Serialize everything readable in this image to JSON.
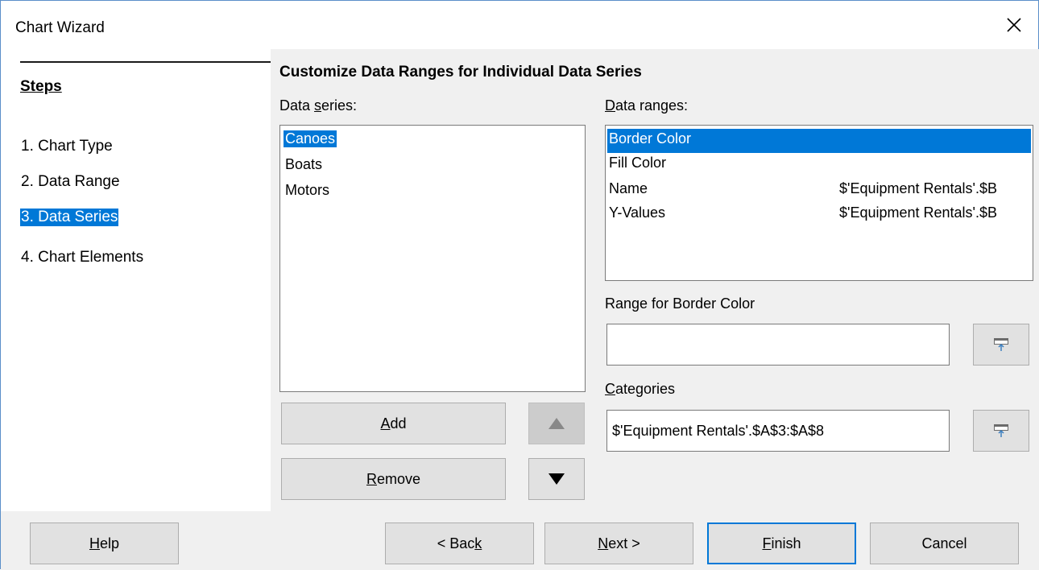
{
  "window": {
    "title": "Chart Wizard"
  },
  "steps": {
    "heading": "Steps",
    "items": [
      {
        "label": "1. Chart Type",
        "active": false
      },
      {
        "label": "2. Data Range",
        "active": false
      },
      {
        "label": "3. Data Series",
        "active": true
      },
      {
        "label": "4. Chart Elements",
        "active": false
      }
    ]
  },
  "main": {
    "section_title": "Customize Data Ranges for Individual Data Series",
    "data_series": {
      "label_pre": "Data ",
      "label_key": "s",
      "label_post": "eries:",
      "items": [
        "Canoes",
        "Boats",
        "Motors"
      ],
      "selected": "Canoes"
    },
    "data_ranges": {
      "label_key": "D",
      "label_post": "ata ranges:",
      "rows": [
        {
          "name": "Border Color",
          "value": ""
        },
        {
          "name": "Fill Color",
          "value": ""
        },
        {
          "name": "Name",
          "value": "$'Equipment Rentals'.$B"
        },
        {
          "name": "Y-Values",
          "value": "$'Equipment Rentals'.$B"
        }
      ],
      "selected": "Border Color"
    },
    "range_for": {
      "label_pre": "Ran",
      "label_key": "g",
      "label_post": "e for Border Color",
      "value": ""
    },
    "categories": {
      "label_key": "C",
      "label_post": "ategories",
      "value": "$'Equipment Rentals'.$A$3:$A$8"
    },
    "buttons": {
      "add_key": "A",
      "add_post": "dd",
      "remove_key": "R",
      "remove_post": "emove"
    }
  },
  "footer": {
    "help_key": "H",
    "help_post": "elp",
    "back_pre": "< Bac",
    "back_key": "k",
    "next_key": "N",
    "next_post": "ext >",
    "finish_key": "F",
    "finish_post": "inish",
    "cancel": "Cancel"
  },
  "colors": {
    "accent": "#0078d7",
    "panel": "#f0f0f0",
    "button": "#e1e1e1"
  },
  "icons": [
    "close-icon",
    "move-up-icon",
    "move-down-icon",
    "shrink-range-icon"
  ]
}
